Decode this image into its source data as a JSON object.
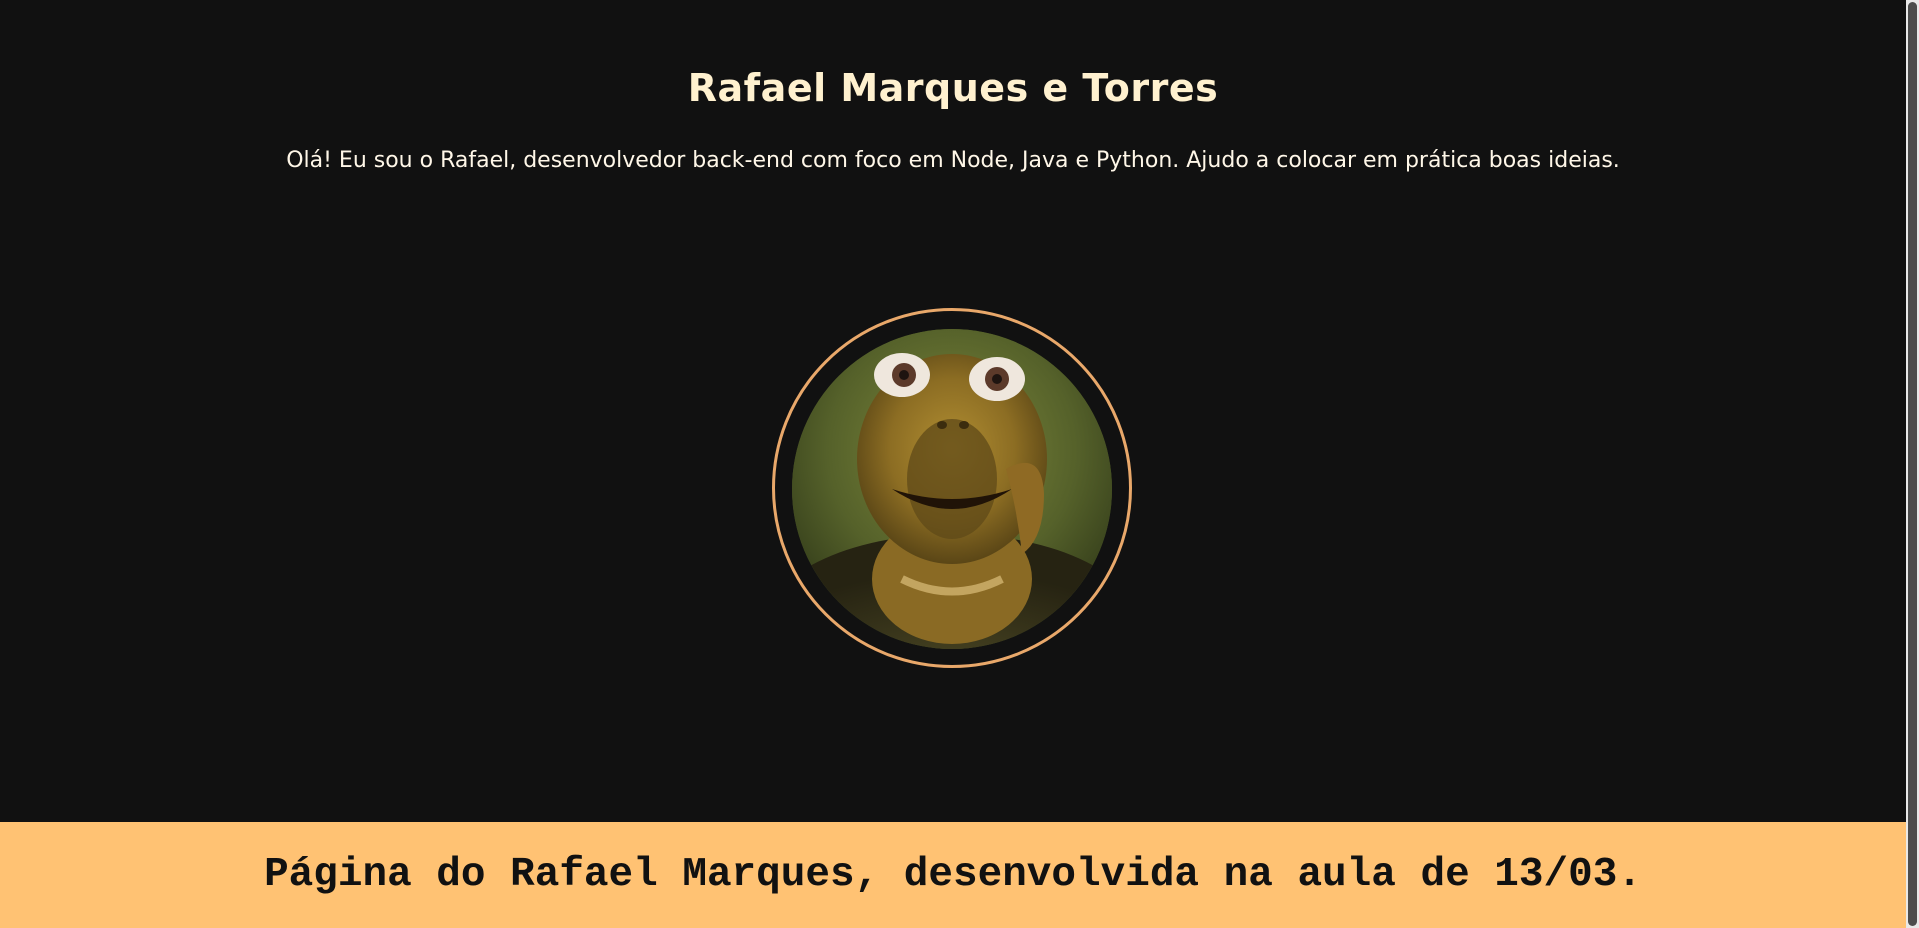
{
  "header": {
    "title": "Rafael Marques e Torres",
    "bio": "Olá! Eu sou o Rafael, desenvolvedor back-end com foco em Node, Java e Python. Ajudo a colocar em prática boas ideias."
  },
  "profile": {
    "avatar_icon": "turtle-avatar-icon",
    "ring_color": "#e9a86a"
  },
  "footer": {
    "text": "Página do Rafael Marques, desenvolvida na aula de 13/03.",
    "background": "#ffc273"
  },
  "colors": {
    "page_background": "#111111",
    "title": "#fff1cf"
  }
}
